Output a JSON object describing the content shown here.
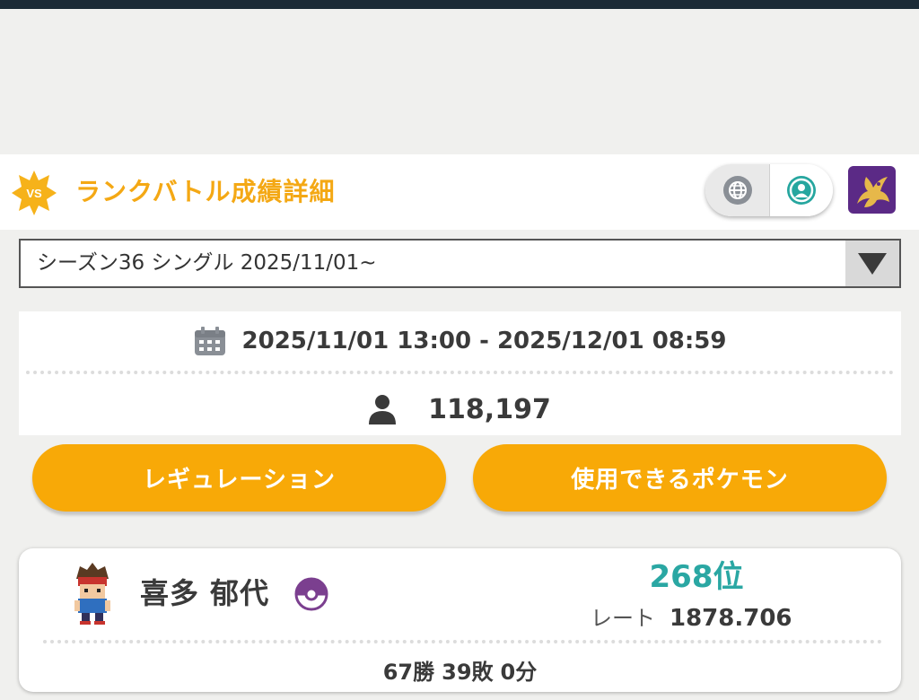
{
  "header": {
    "badge_text": "VS",
    "title": "ランクバトル成績詳細",
    "accent_color": "#f4a814",
    "toggle": {
      "left_icon": "globe-icon",
      "right_icon": "user-circle-icon",
      "active": "right"
    },
    "game_icon": "legendary-dragon-icon"
  },
  "season_select": {
    "value": "シーズン36 シングル 2025/11/01~",
    "dropdown_icon": "triangle-down-icon"
  },
  "season_info": {
    "period": "2025/11/01 13:00 - 2025/12/01 08:59",
    "period_icon": "calendar-icon",
    "player_count": "118,197",
    "player_count_icon": "person-icon"
  },
  "buttons": {
    "regulation": "レギュレーション",
    "usable_pokemon": "使用できるポケモン",
    "color": "#f8a907"
  },
  "player": {
    "name": "喜多 郁代",
    "avatar_icon": "trainer-avatar-icon",
    "ball_icon": "master-ball-icon",
    "rank": "268位",
    "rank_color": "#2aa7a3",
    "rate_label": "レート",
    "rate_value": "1878.706",
    "wins": "67勝",
    "losses": "39敗",
    "draws": "0分"
  }
}
